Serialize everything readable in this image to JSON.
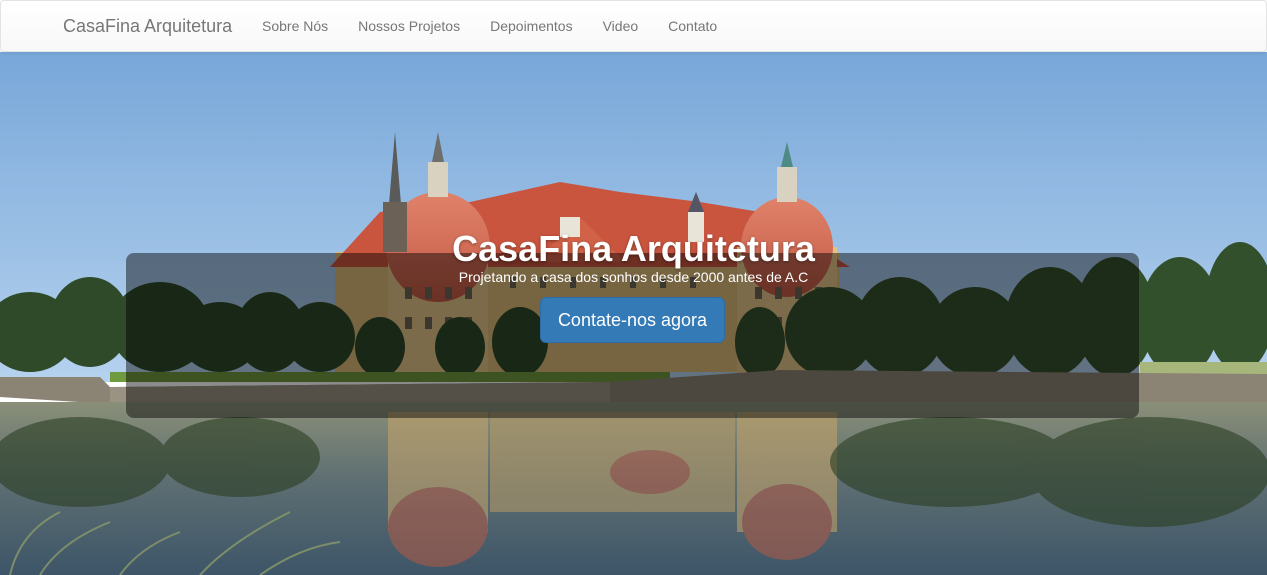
{
  "navbar": {
    "brand": "CasaFina Arquitetura",
    "links": [
      "Sobre Nós",
      "Nossos Projetos",
      "Depoimentos",
      "Video",
      "Contato"
    ]
  },
  "hero": {
    "title": "CasaFina Arquitetura",
    "subtitle": "Projetando a casa dos sonhos desde 2000 antes de A.C",
    "cta_label": "Contate-nos agora"
  },
  "colors": {
    "primary": "#337ab7",
    "nav_text": "#777777",
    "sky": "#8fb8e4",
    "water": "#5c7386"
  }
}
